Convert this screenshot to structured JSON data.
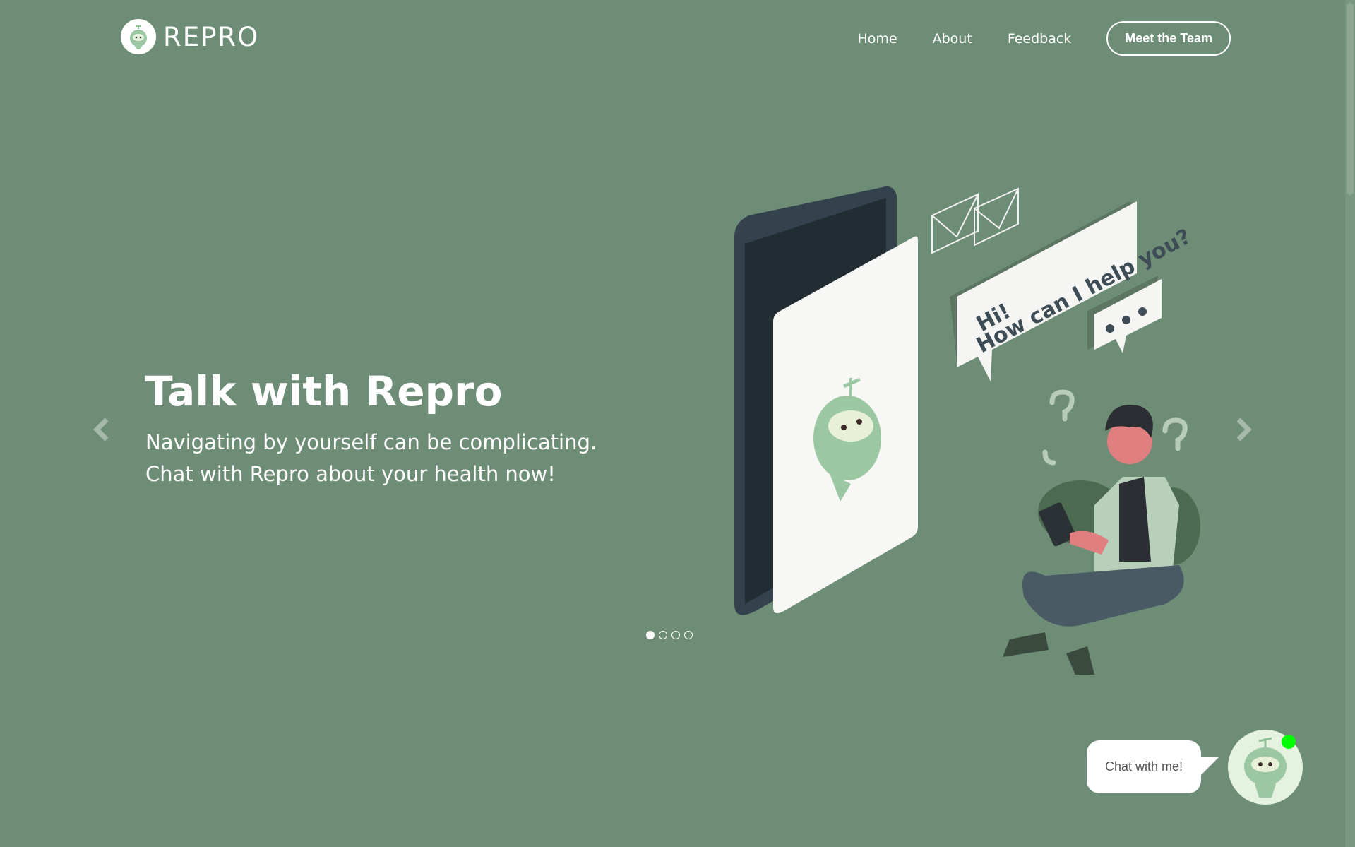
{
  "header": {
    "logo_text": "REPRO",
    "nav": {
      "home": "Home",
      "about": "About",
      "feedback": "Feedback",
      "team_button": "Meet the Team"
    }
  },
  "hero": {
    "title": "Talk with Repro",
    "line1": "Navigating by yourself can be complicating.",
    "line2": "Chat with Repro about your health now!"
  },
  "carousel": {
    "slide_count": 4,
    "active_index": 0
  },
  "illustration": {
    "speech_line1": "Hi!",
    "speech_line2": "How can I help you?"
  },
  "chat_widget": {
    "bubble_text": "Chat with me!",
    "status_color": "#00ff00"
  },
  "colors": {
    "background": "#6e8d77",
    "accent_light": "#a8c9ab"
  }
}
